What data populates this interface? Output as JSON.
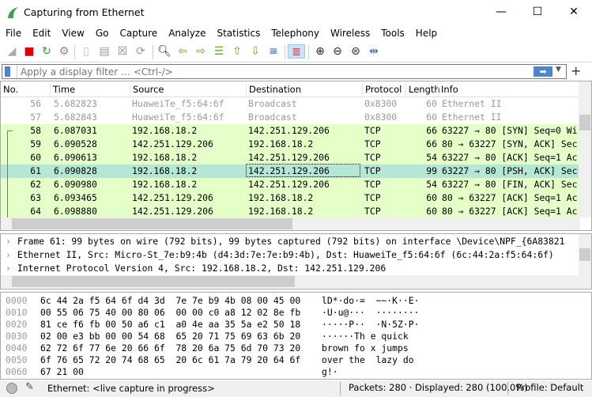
{
  "window": {
    "title": "Capturing from Ethernet",
    "minimize": "—",
    "maximize": "☐",
    "close": "✕"
  },
  "menu": [
    "File",
    "Edit",
    "View",
    "Go",
    "Capture",
    "Analyze",
    "Statistics",
    "Telephony",
    "Wireless",
    "Tools",
    "Help"
  ],
  "toolbar": [
    {
      "name": "start-capture-icon",
      "glyph": "◢",
      "color": "#aaa"
    },
    {
      "name": "stop-capture-icon",
      "glyph": "■",
      "color": "#d00"
    },
    {
      "name": "restart-capture-icon",
      "glyph": "↻",
      "color": "#2a2"
    },
    {
      "name": "capture-options-icon",
      "glyph": "⚙",
      "color": "#888"
    },
    {
      "name": "open-file-icon",
      "glyph": "▯",
      "color": "#bbb"
    },
    {
      "name": "save-file-icon",
      "glyph": "▤",
      "color": "#999"
    },
    {
      "name": "close-file-icon",
      "glyph": "☒",
      "color": "#888"
    },
    {
      "name": "reload-file-icon",
      "glyph": "⟳",
      "color": "#999"
    },
    {
      "name": "find-packet-icon",
      "glyph": "🔍︎",
      "color": "#222"
    },
    {
      "name": "go-back-icon",
      "glyph": "⇦",
      "color": "#6a2"
    },
    {
      "name": "go-forward-icon",
      "glyph": "⇨",
      "color": "#6a2"
    },
    {
      "name": "go-to-packet-icon",
      "glyph": "☰",
      "color": "#6a2"
    },
    {
      "name": "first-packet-icon",
      "glyph": "⇧",
      "color": "#6a2"
    },
    {
      "name": "last-packet-icon",
      "glyph": "⇩",
      "color": "#6a2"
    },
    {
      "name": "auto-scroll-icon",
      "glyph": "≡",
      "color": "#36a"
    },
    {
      "name": "colorize-icon",
      "glyph": "≣",
      "color": "#c33"
    },
    {
      "name": "zoom-in-icon",
      "glyph": "⊕",
      "color": "#222"
    },
    {
      "name": "zoom-out-icon",
      "glyph": "⊖",
      "color": "#222"
    },
    {
      "name": "zoom-normal-icon",
      "glyph": "⊜",
      "color": "#222"
    },
    {
      "name": "resize-columns-icon",
      "glyph": "⇹",
      "color": "#36a"
    }
  ],
  "filter": {
    "placeholder": "Apply a display filter … <Ctrl-/>",
    "apply": "➡",
    "dropdown": "▼",
    "add": "+"
  },
  "columns": [
    "No.",
    "Time",
    "Source",
    "Destination",
    "Protocol",
    "Length",
    "Info"
  ],
  "packets": [
    {
      "no": "56",
      "time": "5.682823",
      "src": "HuaweiTe_f5:64:6f",
      "dst": "Broadcast",
      "proto": "0x8300",
      "len": "60",
      "info": "Ethernet II",
      "style": "gray"
    },
    {
      "no": "57",
      "time": "5.682843",
      "src": "HuaweiTe_f5:64:6f",
      "dst": "Broadcast",
      "proto": "0x8300",
      "len": "60",
      "info": "Ethernet II",
      "style": "gray"
    },
    {
      "no": "58",
      "time": "6.087031",
      "src": "192.168.18.2",
      "dst": "142.251.129.206",
      "proto": "TCP",
      "len": "66",
      "info": "63227 → 80 [SYN] Seq=0 Wi",
      "style": "tcp"
    },
    {
      "no": "59",
      "time": "6.090528",
      "src": "142.251.129.206",
      "dst": "192.168.18.2",
      "proto": "TCP",
      "len": "66",
      "info": "80 → 63227 [SYN, ACK] Sec",
      "style": "tcp"
    },
    {
      "no": "60",
      "time": "6.090613",
      "src": "192.168.18.2",
      "dst": "142.251.129.206",
      "proto": "TCP",
      "len": "54",
      "info": "63227 → 80 [ACK] Seq=1 Ac",
      "style": "tcp"
    },
    {
      "no": "61",
      "time": "6.090828",
      "src": "192.168.18.2",
      "dst": "142.251.129.206",
      "proto": "TCP",
      "len": "99",
      "info": "63227 → 80 [PSH, ACK] Sec",
      "style": "selected"
    },
    {
      "no": "62",
      "time": "6.090980",
      "src": "192.168.18.2",
      "dst": "142.251.129.206",
      "proto": "TCP",
      "len": "54",
      "info": "63227 → 80 [FIN, ACK] Sec",
      "style": "tcp"
    },
    {
      "no": "63",
      "time": "6.093465",
      "src": "142.251.129.206",
      "dst": "192.168.18.2",
      "proto": "TCP",
      "len": "60",
      "info": "80 → 63227 [ACK] Seq=1 Ac",
      "style": "tcp"
    },
    {
      "no": "64",
      "time": "6.098880",
      "src": "142.251.129.206",
      "dst": "192.168.18.2",
      "proto": "TCP",
      "len": "60",
      "info": "80 → 63227 [ACK] Seq=1 Ac",
      "style": "tcp"
    }
  ],
  "details": [
    "Frame 61: 99 bytes on wire (792 bits), 99 bytes captured (792 bits) on interface \\Device\\NPF_{6A83821",
    "Ethernet II, Src: Micro-St_7e:b9:4b (d4:3d:7e:7e:b9:4b), Dst: HuaweiTe_f5:64:6f (6c:44:2a:f5:64:6f)",
    "Internet Protocol Version 4, Src: 192.168.18.2, Dst: 142.251.129.206"
  ],
  "bytes": [
    {
      "off": "0000",
      "hex": "6c 44 2a f5 64 6f d4 3d  7e 7e b9 4b 08 00 45 00",
      "ascii": "lD*·do·=  ~~·K··E·"
    },
    {
      "off": "0010",
      "hex": "00 55 06 75 40 00 80 06  00 00 c0 a8 12 02 8e fb",
      "ascii": "·U·u@···  ········"
    },
    {
      "off": "0020",
      "hex": "81 ce f6 fb 00 50 a6 c1  a0 4e aa 35 5a e2 50 18",
      "ascii": "·····P··  ·N·5Z·P·"
    },
    {
      "off": "0030",
      "hex": "02 00 e3 bb 00 00 54 68  65 20 71 75 69 63 6b 20",
      "ascii": "······Th e quick "
    },
    {
      "off": "0040",
      "hex": "62 72 6f 77 6e 20 66 6f  78 20 6a 75 6d 70 73 20",
      "ascii": "brown fo x jumps "
    },
    {
      "off": "0050",
      "hex": "6f 76 65 72 20 74 68 65  20 6c 61 7a 79 20 64 6f",
      "ascii": "over the  lazy do"
    },
    {
      "off": "0060",
      "hex": "67 21 00",
      "ascii": "g!·"
    }
  ],
  "status": {
    "capture": "Ethernet: <live capture in progress>",
    "packets": "Packets: 280 · Displayed: 280 (100.0%)",
    "profile": "Profile: Default"
  },
  "colors": {
    "tcp": "#e4ffc7",
    "selected": "#b5e6d6",
    "gray_text": "#999999",
    "accent": "#4a86c8"
  }
}
